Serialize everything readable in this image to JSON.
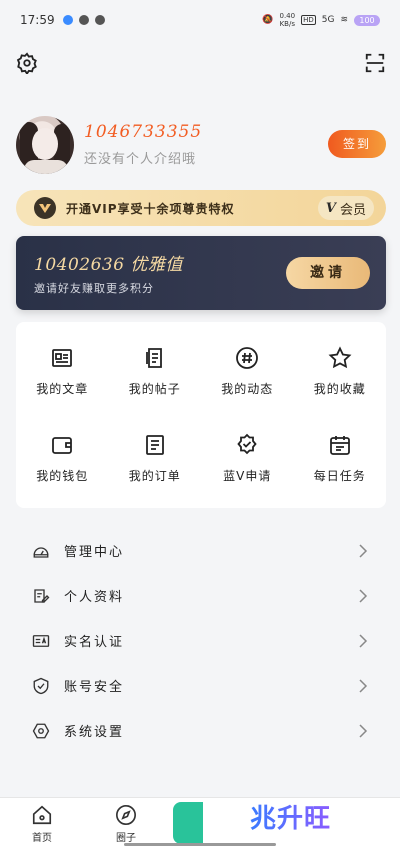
{
  "status_bar": {
    "time": "17:59",
    "net_speed": "0.40",
    "net_unit": "KB/s",
    "hd": "HD",
    "signal": "5G",
    "battery": "100"
  },
  "top_bar": {
    "settings_icon": "gear-icon",
    "scan_icon": "scan-icon"
  },
  "profile": {
    "user_id": "1046733355",
    "bio_placeholder": "还没有个人介绍哦",
    "checkin_label": "签到"
  },
  "vip_banner": {
    "text": "开通VIP享受十余项尊贵特权",
    "badge_label": "会员",
    "badge_v": "V"
  },
  "points_card": {
    "value": "10402636 优雅值",
    "subtitle": "邀请好友赚取更多积分",
    "invite_label": "邀请"
  },
  "features": [
    {
      "label": "我的文章",
      "icon": "article-icon"
    },
    {
      "label": "我的帖子",
      "icon": "post-icon"
    },
    {
      "label": "我的动态",
      "icon": "hashtag-icon"
    },
    {
      "label": "我的收藏",
      "icon": "star-icon"
    },
    {
      "label": "我的钱包",
      "icon": "wallet-icon"
    },
    {
      "label": "我的订单",
      "icon": "order-icon"
    },
    {
      "label": "蓝V申请",
      "icon": "verified-badge-icon"
    },
    {
      "label": "每日任务",
      "icon": "calendar-icon"
    }
  ],
  "menu": [
    {
      "label": "管理中心",
      "icon": "dashboard-icon"
    },
    {
      "label": "个人资料",
      "icon": "edit-profile-icon"
    },
    {
      "label": "实名认证",
      "icon": "id-card-icon"
    },
    {
      "label": "账号安全",
      "icon": "shield-check-icon"
    },
    {
      "label": "系统设置",
      "icon": "settings-hexagon-icon"
    }
  ],
  "bottom_nav": {
    "home_label": "首页",
    "circle_label": "圈子",
    "brand": "兆升旺"
  }
}
